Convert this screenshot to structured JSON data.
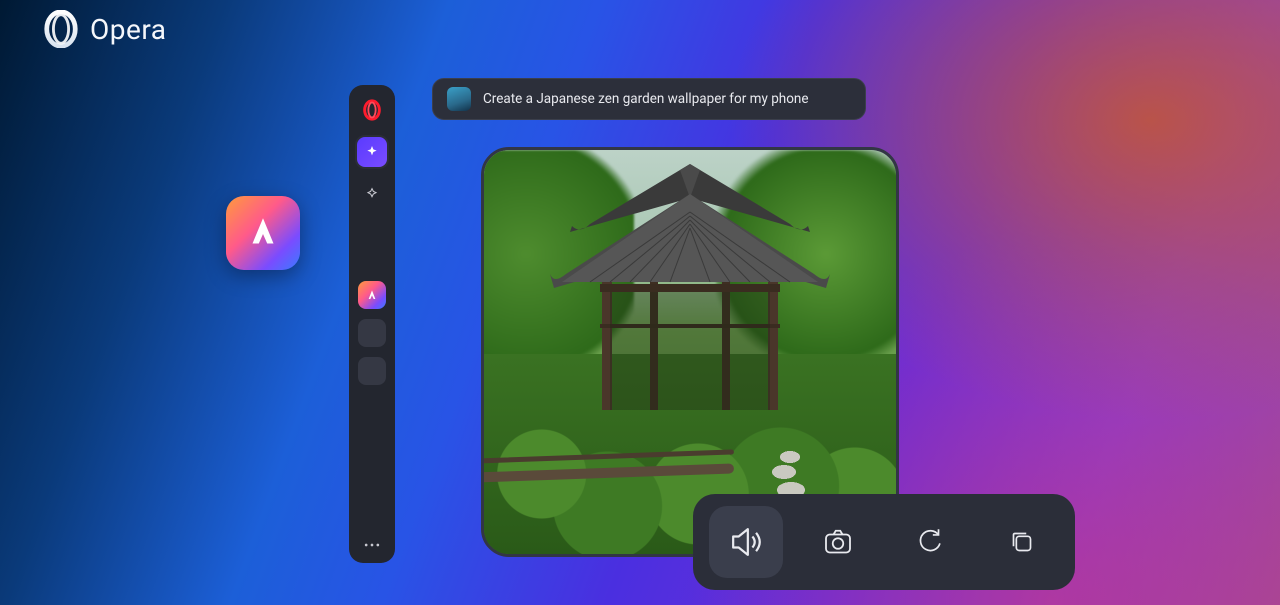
{
  "brand": {
    "name": "Opera"
  },
  "sidebar": {
    "icons": {
      "opera": "opera-icon",
      "aria": "aria-sparkle-icon",
      "center": "center-target-icon",
      "aria_mini": "aria-app-icon",
      "more": "more-icon"
    }
  },
  "prompt": {
    "text": "Create a Japanese zen garden  wallpaper for my phone"
  },
  "result": {
    "alt": "Japanese zen garden with pavilion, moss, trees, stone path and wooden bridge"
  },
  "actions": {
    "sound": "sound-icon",
    "camera": "camera-icon",
    "refresh": "refresh-icon",
    "copy": "copy-icon"
  },
  "colors": {
    "panel": "#2b2e39",
    "sidebar": "#23262f",
    "accent_purple": "#6a3bff",
    "opera_red": "#ff1b2d"
  }
}
